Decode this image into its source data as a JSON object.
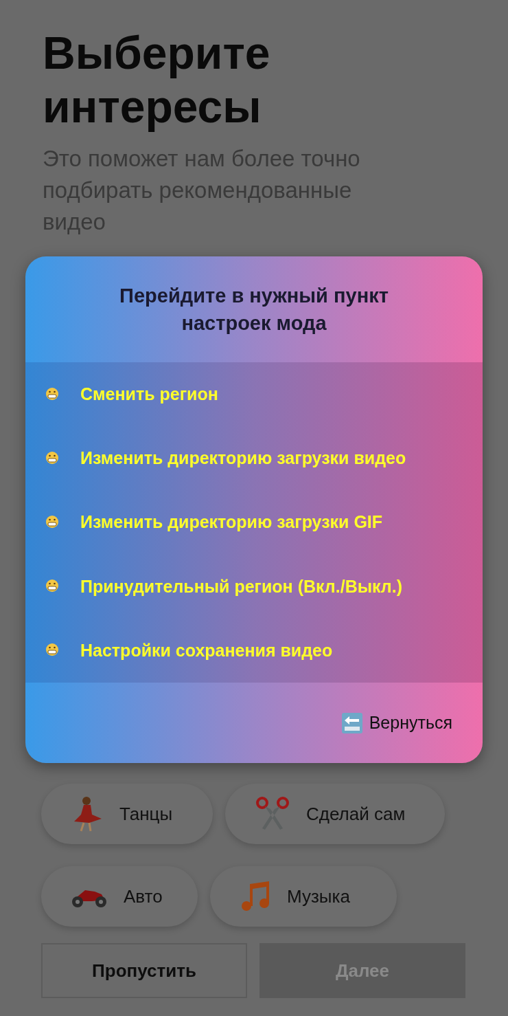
{
  "title": "Выберите интересы",
  "subtitle": "Это поможет нам более точно подбирать рекомендованные видео",
  "chips": [
    {
      "label": "Танцы"
    },
    {
      "label": "Сделай сам"
    },
    {
      "label": "Авто"
    },
    {
      "label": "Музыка"
    }
  ],
  "buttons": [
    {
      "label": "Пропустить",
      "disabled": false
    },
    {
      "label": "Далее",
      "disabled": true
    }
  ],
  "dialog": {
    "title": "Перейдите в нужный пункт настроек мода",
    "items": [
      "Сменить регион",
      "Изменить директорию загрузки видео",
      "Изменить директорию загрузки GIF",
      "Принудительный регион (Вкл./Выкл.)",
      "Настройки сохранения видео"
    ],
    "back": "Вернуться"
  }
}
